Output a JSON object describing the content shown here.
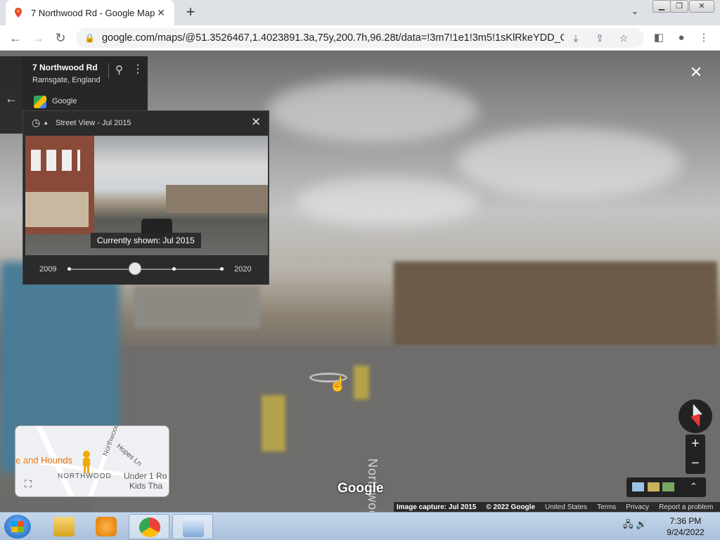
{
  "browser": {
    "tab_title": "7 Northwood Rd - Google Maps",
    "tab_close": "✕",
    "new_tab": "+",
    "url": "google.com/maps/@51.3526467,1.4023891.3a,75y,200.7h,96.28t/data=!3m7!1e1!3m5!1sKlRkeYDD_GU0pKf..."
  },
  "place": {
    "name": "7 Northwood Rd",
    "locality": "Ramsgate, England",
    "source": "Google"
  },
  "timeline": {
    "header": "Street View - Jul 2015",
    "caption": "Currently shown: Jul 2015",
    "start_year": "2009",
    "end_year": "2020"
  },
  "scene": {
    "road_label": "Northwood Rd",
    "watermark": "Google"
  },
  "minimap": {
    "labels": [
      "Northwood",
      "Hopes Ln",
      "e and Hounds",
      "NORTHWOOD",
      "Under 1 Ro",
      "Kids Tha"
    ]
  },
  "controls": {
    "zoom_in": "+",
    "zoom_out": "−"
  },
  "footer": {
    "capture": "Image capture: Jul 2015",
    "copyright": "© 2022 Google",
    "country": "United States",
    "terms": "Terms",
    "privacy": "Privacy",
    "report": "Report a problem"
  },
  "taskbar": {
    "time": "7:36 PM",
    "date": "9/24/2022"
  }
}
